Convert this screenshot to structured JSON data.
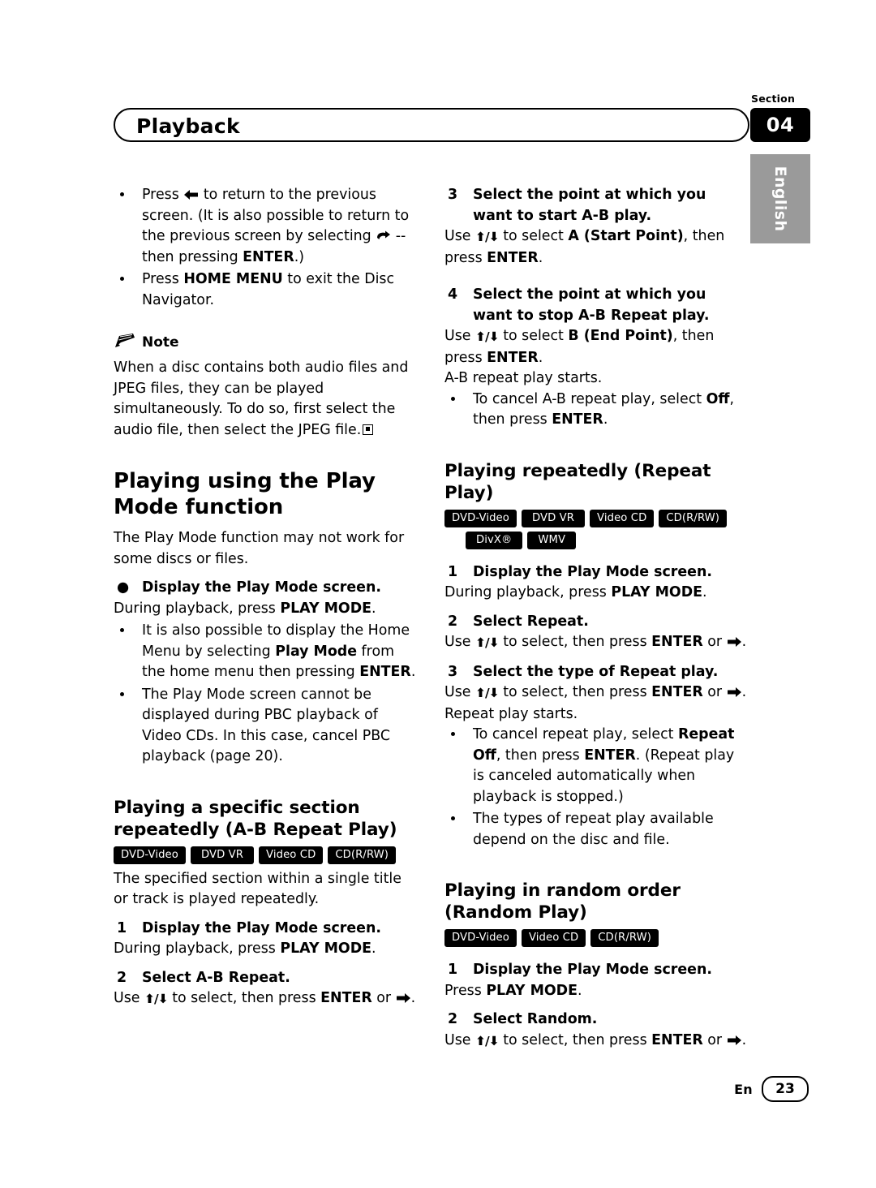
{
  "header": {
    "section_label": "Section",
    "section_number": "04",
    "title": "Playback",
    "language_tab": "English"
  },
  "left_column": {
    "intro_bullets": [
      {
        "pre": "Press ",
        "icon": "left-arrow-icon",
        "mid": " to return to the previous screen. (It is also possible to return to the previous screen by selecting ",
        "icon2": "return-icon",
        "mid2": " -- then pressing ",
        "bold": "ENTER",
        "post": ".)"
      },
      {
        "pre": "Press ",
        "bold": "HOME MENU",
        "post": " to exit the Disc Navigator."
      }
    ],
    "note": {
      "label": "Note",
      "text": "When a disc contains both audio files and JPEG files, they can be played simultaneously. To do so, first select the audio file, then select the JPEG file."
    },
    "section1": {
      "heading": "Playing using the Play Mode function",
      "intro": "The Play Mode function may not work for some discs or files.",
      "bullet_step": {
        "bold": "Display the Play Mode screen.",
        "body_pre": "During playback, press ",
        "body_bold": "PLAY MODE",
        "body_post": "."
      },
      "sub_bullets": [
        {
          "pre": "It is also possible to display the Home Menu by selecting ",
          "bold": "Play Mode",
          "mid": " from the home menu then pressing ",
          "bold2": "ENTER",
          "post": "."
        },
        {
          "pre": "The Play Mode screen cannot be displayed during PBC playback of Video CDs. In this case, cancel PBC playback (page 20)."
        }
      ]
    },
    "section2": {
      "heading": "Playing a specific section repeatedly (A-B Repeat Play)",
      "tags": [
        [
          "DVD-Video",
          "DVD VR",
          "Video CD",
          "CD(R/RW)"
        ]
      ],
      "intro": "The specified section within a single title or track is played repeatedly.",
      "steps": [
        {
          "num": "1",
          "bold": "Display the Play Mode screen.",
          "body_pre": "During playback, press ",
          "body_bold": "PLAY MODE",
          "body_post": "."
        },
        {
          "num": "2",
          "bold": "Select A-B Repeat.",
          "body_pre": "Use ",
          "body_arrows": "up/down",
          "body_mid": " to select, then press ",
          "body_bold": "ENTER",
          "body_or": " or ",
          "body_arrow_right": "right-arrow-icon",
          "body_post": "."
        }
      ]
    }
  },
  "right_column": {
    "ab_steps": [
      {
        "num": "3",
        "bold": "Select the point at which you want to start A-B play.",
        "body_pre": "Use ",
        "body_arrows": "up/down",
        "body_mid": " to select ",
        "body_bold": "A (Start Point)",
        "body_mid2": ", then press ",
        "body_bold2": "ENTER",
        "body_post": "."
      },
      {
        "num": "4",
        "bold": "Select the point at which you want to stop A-B Repeat play.",
        "body_pre": "Use ",
        "body_arrows": "up/down",
        "body_mid": " to select ",
        "body_bold": "B (End Point)",
        "body_mid2": ", then press ",
        "body_bold2": "ENTER",
        "body_post": ".",
        "extra": "A-B repeat play starts."
      }
    ],
    "ab_bullet": {
      "pre": "To cancel A-B repeat play, select ",
      "bold": "Off",
      "mid": ", then press  ",
      "bold2": "ENTER",
      "post": "."
    },
    "section3": {
      "heading": "Playing repeatedly (Repeat Play)",
      "tags": [
        [
          "DVD-Video",
          "DVD VR",
          "Video CD",
          "CD(R/RW)"
        ],
        [
          "DivX®",
          "WMV"
        ]
      ],
      "steps": [
        {
          "num": "1",
          "bold": "Display the Play Mode screen.",
          "body_pre": "During playback, press ",
          "body_bold": "PLAY MODE",
          "body_post": "."
        },
        {
          "num": "2",
          "bold": "Select Repeat.",
          "body_pre": "Use ",
          "body_arrows": "up/down",
          "body_mid": " to select, then press ",
          "body_bold": "ENTER",
          "body_or": " or ",
          "body_arrow_right": "right-arrow-icon",
          "body_post": "."
        },
        {
          "num": "3",
          "bold": "Select the type of Repeat play.",
          "body_pre": "Use ",
          "body_arrows": "up/down",
          "body_mid": " to select, then press ",
          "body_bold": "ENTER",
          "body_or": " or ",
          "body_arrow_right": "right-arrow-icon",
          "body_post": ".",
          "extra": "Repeat play starts."
        }
      ],
      "bullets": [
        {
          "pre": "To cancel repeat play, select ",
          "bold": "Repeat Off",
          "mid": ", then press ",
          "bold2": "ENTER",
          "post": ". (Repeat play is canceled automatically when playback is stopped.)"
        },
        {
          "pre": "The types of repeat play available depend on the disc and file."
        }
      ]
    },
    "section4": {
      "heading": "Playing in random order (Random Play)",
      "tags": [
        [
          "DVD-Video",
          "Video CD",
          "CD(R/RW)"
        ]
      ],
      "steps": [
        {
          "num": "1",
          "bold": "Display the Play Mode screen.",
          "body_pre": "Press ",
          "body_bold": "PLAY MODE",
          "body_post": "."
        },
        {
          "num": "2",
          "bold": "Select Random.",
          "body_pre": "Use ",
          "body_arrows": "up/down",
          "body_mid": " to select, then press ",
          "body_bold": "ENTER",
          "body_or": " or ",
          "body_arrow_right": "right-arrow-icon",
          "body_post": "."
        }
      ]
    }
  },
  "footer": {
    "lang": "En",
    "page": "23"
  }
}
